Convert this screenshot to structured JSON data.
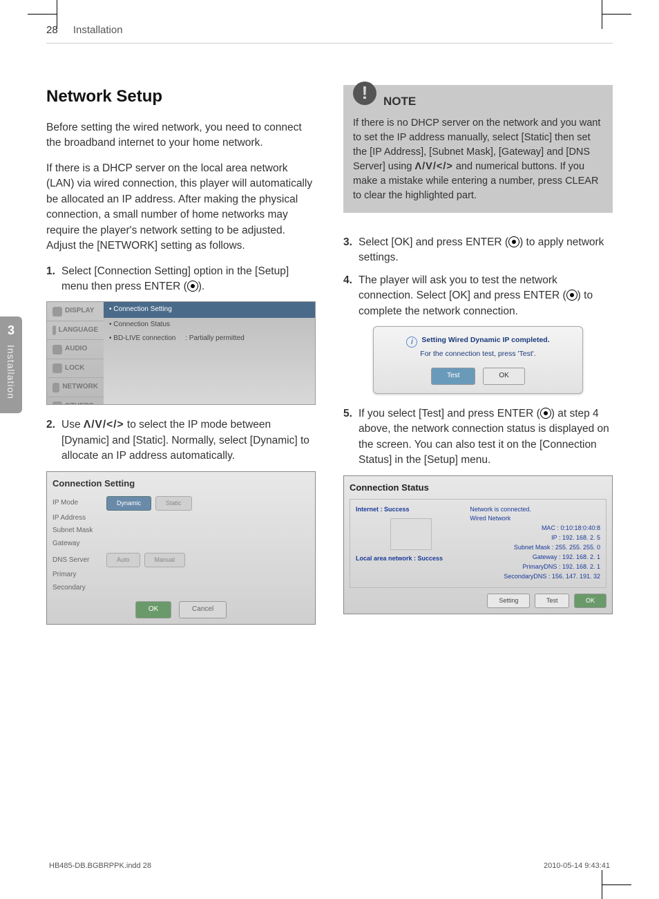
{
  "meta": {
    "page_number": "28",
    "section": "Installation"
  },
  "sidebar": {
    "chapter_number": "3",
    "chapter_label": "Installation"
  },
  "heading": "Network Setup",
  "intro_p1": "Before setting the wired network, you need to connect the broadband internet to your home network.",
  "intro_p2": "If there is a DHCP server on the local area network (LAN) via wired connection, this player will automatically be allocated an IP address. After making the physical connection, a small number of home networks may require the player's network setting to be adjusted. Adjust the [NETWORK] setting as follows.",
  "steps": {
    "s1_pre": "Select [Connection Setting] option in the [Setup] menu then press ENTER (",
    "s1_post": ").",
    "s2_pre": "Use ",
    "s2_arrows": "Λ/V/</>",
    "s2_post": " to select the IP mode between [Dynamic] and [Static]. Normally, select [Dynamic] to allocate an IP address automatically.",
    "s3_pre": "Select [OK] and press ENTER (",
    "s3_post": ") to apply network settings.",
    "s4_pre": "The player will ask you to test the network connection. Select [OK] and press ENTER (",
    "s4_post": ") to complete the network connection.",
    "s5_pre": "If you select [Test] and press ENTER (",
    "s5_post": ") at step 4 above, the network connection status is displayed on the screen. You can also test it on the [Connection Status] in the [Setup] menu."
  },
  "note": {
    "label": "NOTE",
    "pre": "If there is no DHCP server on the network and you want to set the IP address manually, select [Static] then set the [IP Address], [Subnet Mask], [Gateway] and [DNS Server] using ",
    "arrows": "Λ/V/</>",
    "post": " and numerical buttons. If you make a mistake while entering a number, press CLEAR to clear the highlighted part."
  },
  "shot1": {
    "menu": [
      "DISPLAY",
      "LANGUAGE",
      "AUDIO",
      "LOCK",
      "NETWORK",
      "OTHERS"
    ],
    "highlight": "Connection Setting",
    "rows": [
      "Connection Status",
      "BD-LIVE connection"
    ],
    "value": ": Partially permitted"
  },
  "shot2": {
    "title": "Connection Setting",
    "lines": {
      "ipmode": "IP Mode",
      "dynamic": "Dynamic",
      "static": "Static",
      "ipaddr": "IP Address",
      "subnet": "Subnet Mask",
      "gateway": "Gateway",
      "dns": "DNS Server",
      "auto": "Auto",
      "manual": "Manual",
      "primary": "Primary",
      "secondary": "Secondary"
    },
    "ok": "OK",
    "cancel": "Cancel"
  },
  "shot3": {
    "msg1": "Setting Wired Dynamic IP completed.",
    "msg2": "For the connection test, press 'Test'.",
    "test": "Test",
    "ok": "OK"
  },
  "shot4": {
    "title": "Connection Status",
    "internet": "Internet : Success",
    "lan": "Local area network : Success",
    "net_is": "Network is connected.",
    "wired": "Wired Network",
    "mac": "MAC : 0:10:18:0:40:8",
    "ip": "IP : 192. 168. 2. 5",
    "mask": "Subnet Mask : 255. 255. 255. 0",
    "gw": "Gateway : 192. 168. 2. 1",
    "pdns": "PrimaryDNS : 192. 168. 2. 1",
    "sdns": "SecondaryDNS : 156. 147. 191. 32",
    "setting": "Setting",
    "test": "Test",
    "ok": "OK"
  },
  "footer": {
    "file": "HB485-DB.BGBRPPK.indd   28",
    "stamp": "2010-05-14     9:43:41"
  }
}
